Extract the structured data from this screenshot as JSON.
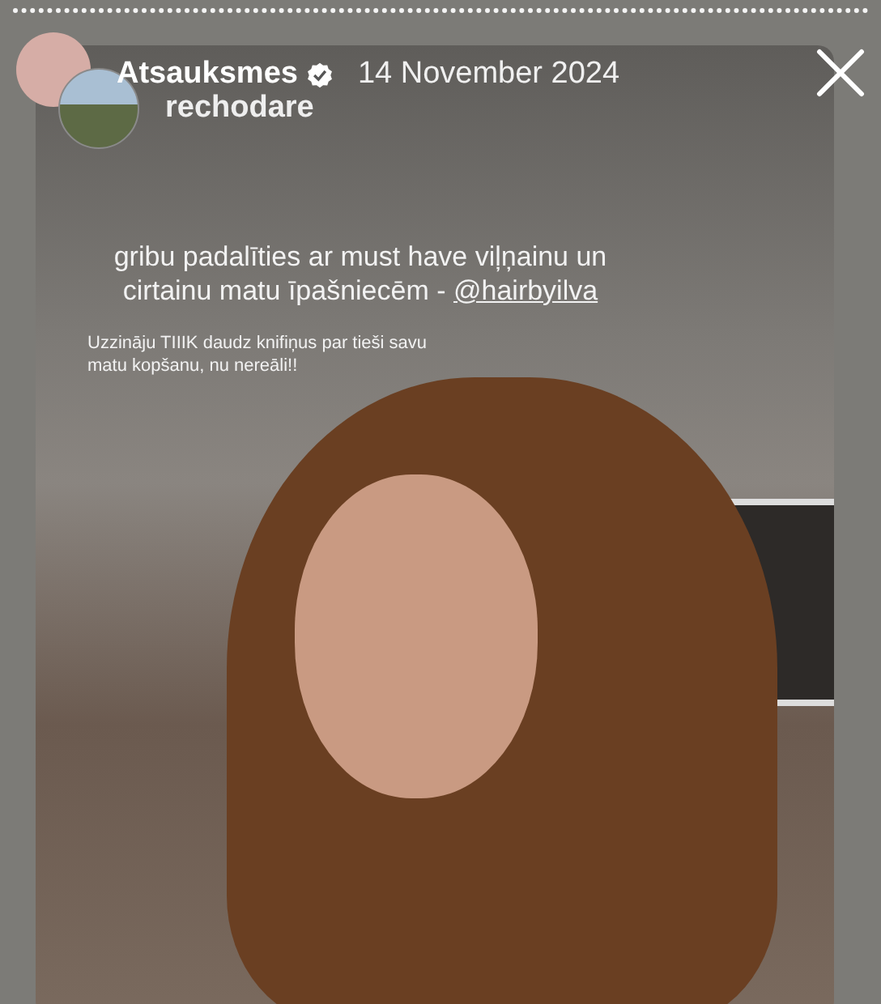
{
  "header": {
    "account": "Atsauksmes",
    "verified": true,
    "date": "14 November 2024",
    "author": "rechodare"
  },
  "story": {
    "caption": "gribu padalīties ar must have viļņainu un cirtainu matu īpašniecēm - ",
    "mention": "@hairbyilva",
    "note": "Uzzināju TIIIK daudz knifiņus par tieši savu matu kopšanu, nu nereāli!!"
  }
}
